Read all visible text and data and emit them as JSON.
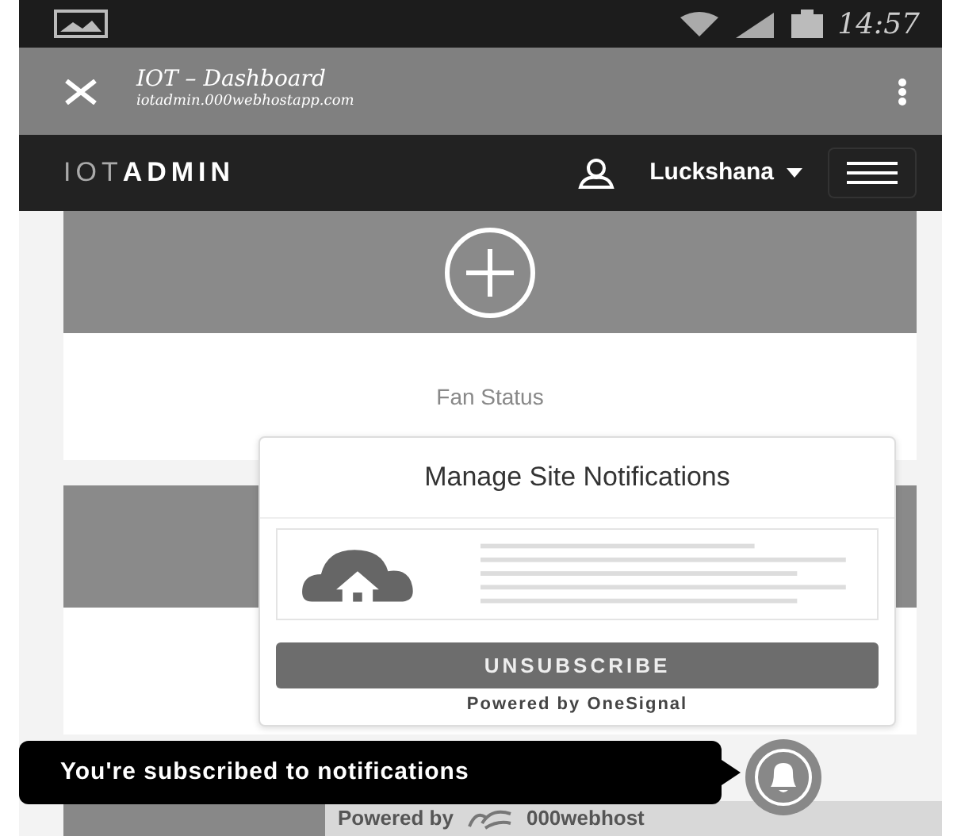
{
  "status_bar": {
    "time": "14:57"
  },
  "browser_bar": {
    "title": "IOT – Dashboard",
    "url": "iotadmin.000webhostapp.com"
  },
  "navbar": {
    "brand_light": "IOT",
    "brand_bold": "ADMIN",
    "user": "Luckshana"
  },
  "cards": [
    {
      "kind": "add",
      "label": "Fan Status"
    },
    {
      "kind": "plain"
    }
  ],
  "popup": {
    "title": "Manage Site Notifications",
    "button": "UNSUBSCRIBE",
    "footer": "Powered by OneSignal"
  },
  "tooltip": {
    "text": "You're subscribed to notifications"
  },
  "hosting_bar": {
    "prefix": "Powered by",
    "brand": "000webhost"
  }
}
